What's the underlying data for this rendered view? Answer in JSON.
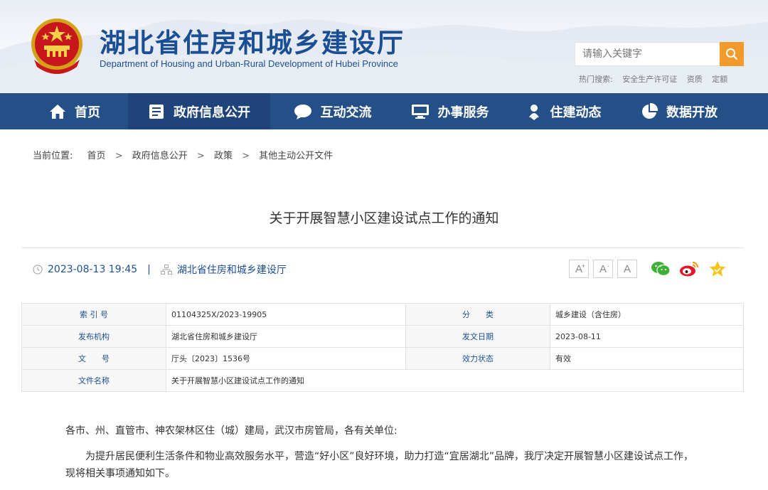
{
  "header": {
    "site_title": "湖北省住房和城乡建设厅",
    "site_subtitle": "Department of Housing and Urban-Rural Development of Hubei Province",
    "search_placeholder": "请输入关键字",
    "hot_search_label": "热门搜索:",
    "hot_search_items": [
      "安全生产许可证",
      "资质",
      "定额"
    ]
  },
  "nav": {
    "items": [
      {
        "label": "首页",
        "icon": "home-icon"
      },
      {
        "label": "政府信息公开",
        "icon": "document-list-icon"
      },
      {
        "label": "互动交流",
        "icon": "chat-bubble-icon"
      },
      {
        "label": "办事服务",
        "icon": "monitor-icon"
      },
      {
        "label": "住建动态",
        "icon": "person-pin-icon"
      },
      {
        "label": "数据开放",
        "icon": "pie-chart-icon"
      }
    ],
    "active_index": 1
  },
  "breadcrumb": {
    "lead": "当前位置:",
    "items": [
      "首页",
      "政府信息公开",
      "政策",
      "其他主动公开文件"
    ],
    "separator": ">"
  },
  "article": {
    "title": "关于开展智慧小区建设试点工作的通知",
    "datetime": "2023-08-13 19:45",
    "source": "湖北省住房和城乡建设厅",
    "meta_divider": "|",
    "font_size_buttons": [
      {
        "label": "A",
        "sup": "+"
      },
      {
        "label": "A",
        "sup": "-"
      },
      {
        "label": "A",
        "sup": ""
      }
    ],
    "share_icons": [
      "wechat-icon",
      "weibo-icon",
      "favorite-star-icon"
    ]
  },
  "info_table": {
    "rows": [
      [
        {
          "key": "索 引 号",
          "value": "01104325X/2023-19905"
        },
        {
          "key": "分　　类",
          "value": "城乡建设（含住房）"
        }
      ],
      [
        {
          "key": "发布机构",
          "value": "湖北省住房和城乡建设厅"
        },
        {
          "key": "发文日期",
          "value": "2023-08-11"
        }
      ],
      [
        {
          "key": "文　　号",
          "value": "厅头〔2023〕1536号"
        },
        {
          "key": "效力状态",
          "value": "有效"
        }
      ],
      [
        {
          "key": "文件名称",
          "value": "关于开展智慧小区建设试点工作的通知"
        }
      ]
    ]
  },
  "body": {
    "salutation": "各市、州、直管市、神农架林区住（城）建局，武汉市房管局，各有关单位:",
    "paragraph_1_line_1": "为提升居民便利生活条件和物业高效服务水平，营造“好小区”良好环境，助力打造“宜居湖北”品牌，我厅决定开展智慧小区建设试点工作，",
    "paragraph_1_line_2": "现将相关事项通知如下。"
  },
  "colors": {
    "brand_blue": "#1b4f93",
    "nav_bg": "#244f87",
    "nav_active_bg": "#1e4479",
    "search_button": "#f39a2c"
  }
}
